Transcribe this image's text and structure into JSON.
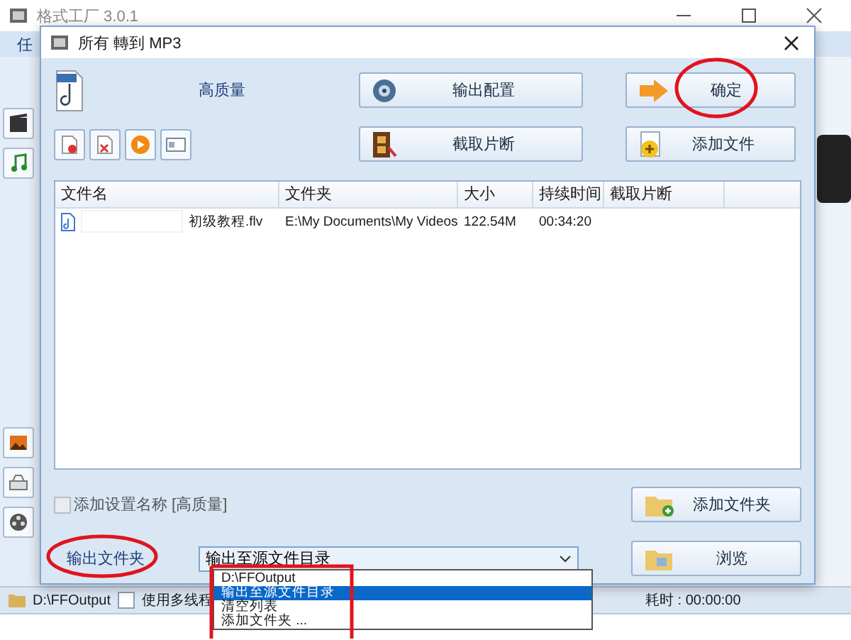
{
  "app_window": {
    "title": "格式工厂 3.0.1",
    "menu": [
      "任"
    ],
    "status_bar": {
      "output_path": "D:\\FFOutput",
      "multithread": {
        "label": "使用多线程",
        "checked": false
      },
      "elapsed": "耗时 : 00:00:00"
    }
  },
  "dialog": {
    "title": "所有 轉到 MP3",
    "profile": "高质量",
    "buttons": [
      {
        "label": "输出配置",
        "kind": "config"
      },
      {
        "label": "确定",
        "kind": "ok"
      },
      {
        "label": "截取片断",
        "kind": "clip"
      },
      {
        "label": "添加文件",
        "kind": "add-file"
      }
    ],
    "table": {
      "columns": [
        "文件名",
        "文件夹",
        "大小",
        "持续时间",
        "截取片断"
      ],
      "rows": [
        {
          "name": "初级教程.flv",
          "folder": "E:\\My Documents\\My Videos",
          "size": "122.54M",
          "duration": "00:34:20"
        }
      ]
    },
    "add_profile_name": {
      "label": "添加设置名称 [高质量]",
      "checked": false,
      "disabled": true
    },
    "add_folder_button": "添加文件夹",
    "output_folder": {
      "label": "输出文件夹",
      "value": "输出至源文件目录",
      "expanded": true,
      "options": [
        {
          "label": "D:\\FFOutput",
          "selected": false
        },
        {
          "label": "输出至源文件目录",
          "selected": true
        },
        {
          "label": "清空列表",
          "selected": false
        },
        {
          "label": "添加文件夹 ...",
          "selected": false
        }
      ]
    },
    "browse_button": "浏览"
  }
}
